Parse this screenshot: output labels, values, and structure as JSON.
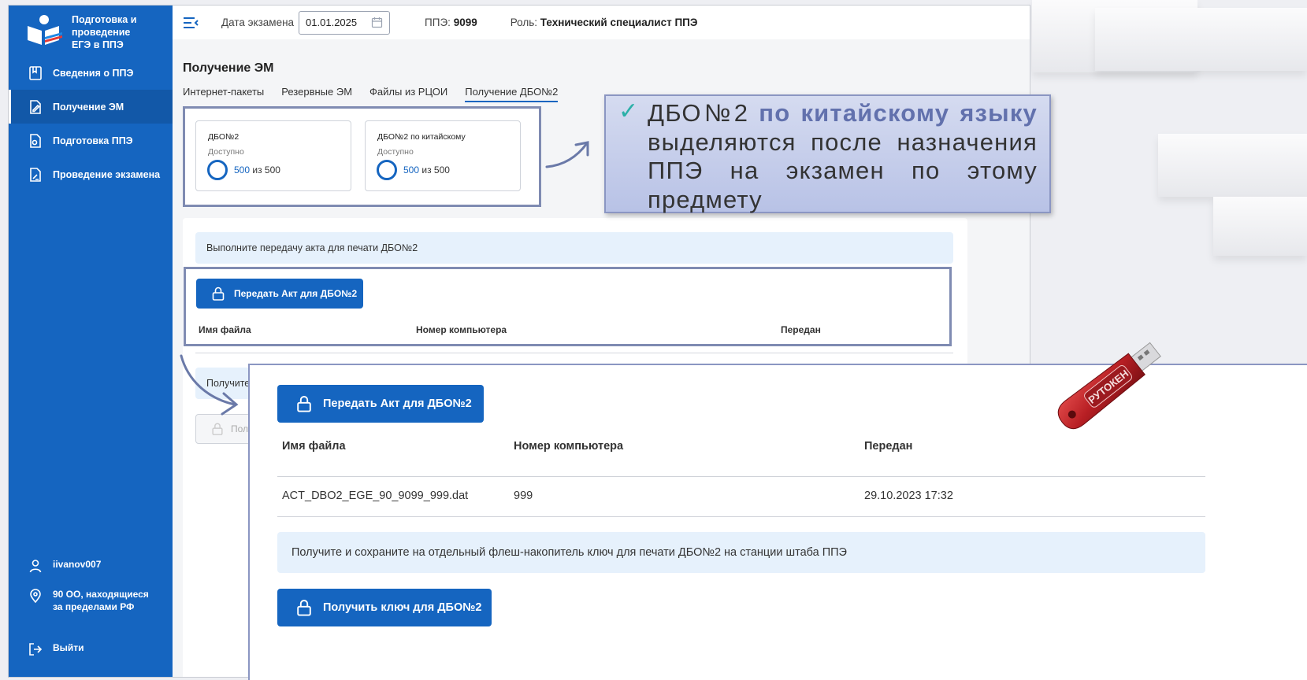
{
  "sidebar": {
    "logo_line1": "Подготовка и",
    "logo_line2": "проведение",
    "logo_line3": "ЕГЭ в ППЭ",
    "items": [
      {
        "label": "Сведения о ППЭ",
        "icon": "book-icon"
      },
      {
        "label": "Получение ЭМ",
        "icon": "document-edit-icon"
      },
      {
        "label": "Подготовка ППЭ",
        "icon": "document-settings-icon"
      },
      {
        "label": "Проведение экзамена",
        "icon": "document-pen-icon"
      }
    ],
    "user": "iivanov007",
    "region": "90 ОО, находящиеся за пределами РФ",
    "logout": "Выйти"
  },
  "topbar": {
    "date_label": "Дата экзамена",
    "date_value": "01.01.2025",
    "ppe_label": "ППЭ:",
    "ppe_value": "9099",
    "role_label": "Роль:",
    "role_value": "Технический специалист ППЭ"
  },
  "main": {
    "title": "Получение ЭМ",
    "tabs": [
      "Интернет-пакеты",
      "Резервные ЭМ",
      "Файлы из РЦОИ",
      "Получение ДБО№2"
    ],
    "cards": [
      {
        "title": "ДБО№2",
        "status": "Доступно",
        "count": "500",
        "of_total": "из 500"
      },
      {
        "title": "ДБО№2 по китайскому",
        "status": "Доступно",
        "count": "500",
        "of_total": "из 500"
      }
    ],
    "info_text": "Выполните передачу акта для печати ДБО№2",
    "act_button": "Передать Акт для ДБО№2",
    "columns": [
      "Имя файла",
      "Номер компьютера",
      "Передан"
    ],
    "info_text2_partial": "Получите и",
    "ghost_button_partial": "Полу"
  },
  "callout": {
    "check": "✓",
    "part1": "ДБО№2 ",
    "highlight": "по китайскому языку",
    "part2": " выделяются после назначения ППЭ на экзамен по этому предмету"
  },
  "zoom": {
    "act_button": "Передать Акт для ДБО№2",
    "columns": [
      "Имя файла",
      "Номер компьютера",
      "Передан"
    ],
    "row": {
      "file": "ACT_DBO2_EGE_90_9099_999.dat",
      "computer": "999",
      "sent": "29.10.2023 17:32"
    },
    "info_text": "Получите и сохраните на отдельный флеш-накопитель ключ для печати ДБО№2 на станции штаба ППЭ",
    "key_button": "Получить ключ для ДБО№2"
  },
  "token": {
    "label": "РУТОКЕН"
  },
  "colors": {
    "primary": "#1565c0",
    "callout_bg": "#c4cbeb",
    "highlight": "#6271ad",
    "frame": "#7f8bb2"
  }
}
